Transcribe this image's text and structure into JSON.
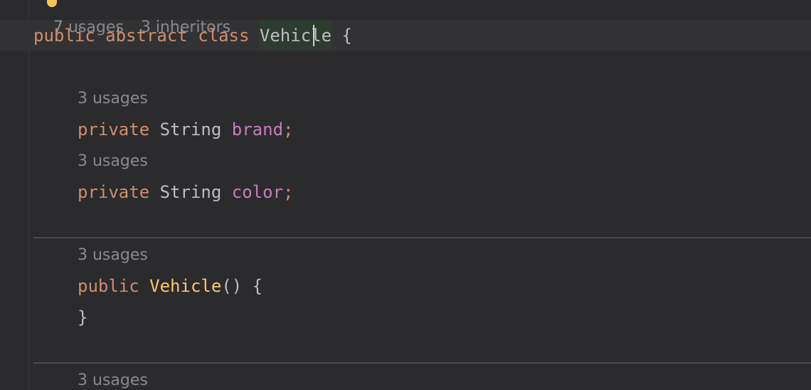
{
  "class_header": {
    "usages": "7 usages",
    "inheritors": "3 inheritors",
    "kw_public": "public",
    "kw_abstract": "abstract",
    "kw_class": "class",
    "class_name_before_caret": "Vehic",
    "class_name_after_caret": "le",
    "brace_open": "{"
  },
  "fields": [
    {
      "usages": "3 usages",
      "modifier": "private",
      "type": "String",
      "name": "brand",
      "semicolon": ";"
    },
    {
      "usages": "3 usages",
      "modifier": "private",
      "type": "String",
      "name": "color",
      "semicolon": ";"
    }
  ],
  "constructor": {
    "usages": "3 usages",
    "modifier": "public",
    "name": "Vehicle",
    "params": "()",
    "brace_open": "{",
    "brace_close": "}"
  },
  "next_member": {
    "usages": "3 usages"
  },
  "colors": {
    "background": "#2b2b2d",
    "keyword": "#cf8e6d",
    "field": "#c77dbb",
    "method": "#ffc66d",
    "text": "#bcbec4",
    "hint": "#868a91",
    "identifier_highlight": "#2e3b30"
  },
  "icons": {
    "intention": "lightbulb-icon"
  }
}
